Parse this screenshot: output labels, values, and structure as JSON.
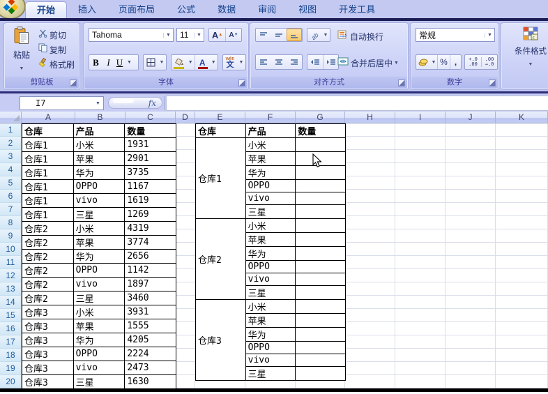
{
  "tabs": [
    {
      "label": "开始",
      "active": true
    },
    {
      "label": "插入",
      "active": false
    },
    {
      "label": "页面布局",
      "active": false
    },
    {
      "label": "公式",
      "active": false
    },
    {
      "label": "数据",
      "active": false
    },
    {
      "label": "审阅",
      "active": false
    },
    {
      "label": "视图",
      "active": false
    },
    {
      "label": "开发工具",
      "active": false
    }
  ],
  "ribbon": {
    "clipboard": {
      "label": "剪贴板",
      "paste": "粘贴",
      "cut": "剪切",
      "copy": "复制",
      "format_painter": "格式刷"
    },
    "font": {
      "label": "字体",
      "name": "Tahoma",
      "size": "11",
      "bold": "B",
      "italic": "I",
      "underline": "U",
      "grow_shrink": "A",
      "phonetic_small": "wén",
      "phonetic": "文"
    },
    "alignment": {
      "label": "对齐方式",
      "wrap_text": "自动换行",
      "merge_center": "合并后居中",
      "orientation_glyph": "ab"
    },
    "number": {
      "label": "数字",
      "format": "常规",
      "percent": "%",
      "comma": ",",
      "inc_decimal_top": "+.0",
      "inc_decimal_bottom": ".00",
      "dec_decimal_top": ".00",
      "dec_decimal_bottom": "→.0"
    },
    "styles": {
      "conditional_format": "条件格式"
    }
  },
  "formula_bar": {
    "name_box": "I7",
    "fx": "fx"
  },
  "sheet": {
    "column_letters": [
      "A",
      "B",
      "C",
      "D",
      "E",
      "F",
      "G",
      "H",
      "I",
      "J",
      "K"
    ],
    "row_count": 20,
    "left_table": {
      "headers": [
        "仓库",
        "产品",
        "数量"
      ],
      "rows": [
        [
          "仓库1",
          "小米",
          "1931"
        ],
        [
          "仓库1",
          "苹果",
          "2901"
        ],
        [
          "仓库1",
          "华为",
          "3735"
        ],
        [
          "仓库1",
          "OPPO",
          "1167"
        ],
        [
          "仓库1",
          "vivo",
          "1619"
        ],
        [
          "仓库1",
          "三星",
          "1269"
        ],
        [
          "仓库2",
          "小米",
          "4319"
        ],
        [
          "仓库2",
          "苹果",
          "3774"
        ],
        [
          "仓库2",
          "华为",
          "2656"
        ],
        [
          "仓库2",
          "OPPO",
          "1142"
        ],
        [
          "仓库2",
          "vivo",
          "1897"
        ],
        [
          "仓库2",
          "三星",
          "3460"
        ],
        [
          "仓库3",
          "小米",
          "3931"
        ],
        [
          "仓库3",
          "苹果",
          "1555"
        ],
        [
          "仓库3",
          "华为",
          "4205"
        ],
        [
          "仓库3",
          "OPPO",
          "2224"
        ],
        [
          "仓库3",
          "vivo",
          "2473"
        ],
        [
          "仓库3",
          "三星",
          "1630"
        ]
      ]
    },
    "right_table": {
      "headers": [
        "仓库",
        "产品",
        "数量"
      ],
      "warehouses": [
        "仓库1",
        "仓库2",
        "仓库3"
      ],
      "products": [
        "小米",
        "苹果",
        "华为",
        "OPPO",
        "vivo",
        "三星"
      ]
    }
  },
  "colors": {
    "tab_text": "#15428b",
    "ribbon_bg": "#bdc4ef",
    "active_align_highlight": "#fbc96a",
    "row_header_text": "#1f5c9e",
    "table_border": "#000000"
  }
}
